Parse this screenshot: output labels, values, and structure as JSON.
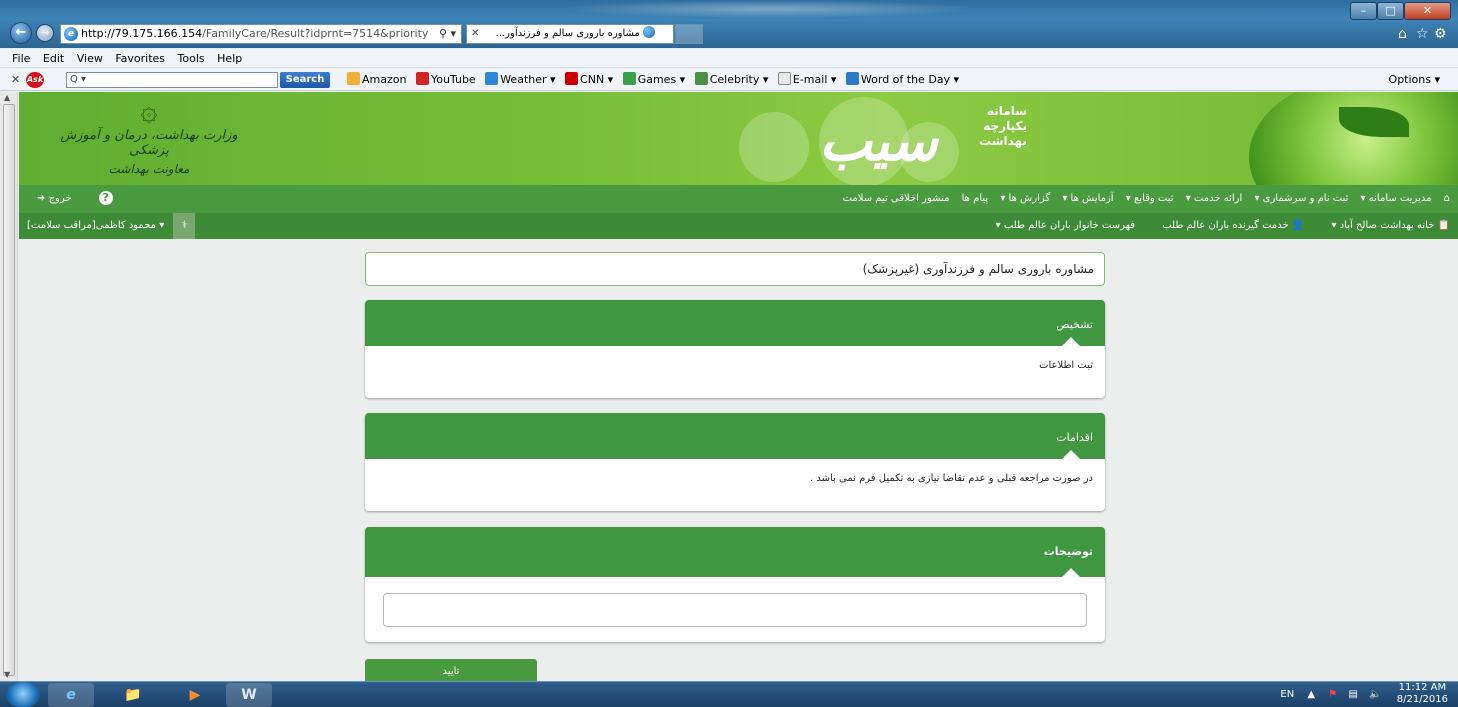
{
  "browser": {
    "address": {
      "host": "http://79.175.166.154",
      "path": "/FamilyCare/Result?idprnt=7514&priority"
    },
    "tab_title": "مشاوره باروری سالم و فرزندآور...",
    "menu": [
      "File",
      "Edit",
      "View",
      "Favorites",
      "Tools",
      "Help"
    ],
    "toolbar": {
      "search_button": "Search",
      "links": [
        "Amazon",
        "YouTube",
        "Weather ▾",
        "CNN ▾",
        "Games ▾",
        "Celebrity ▾",
        "E-mail ▾",
        "Word of the Day ▾"
      ],
      "options": "Options ▾"
    }
  },
  "header": {
    "ministry_line1": "وزارت بهداشت، درمان و آموزش پزشکی",
    "ministry_line2": "معاونت بهداشت",
    "brand_lines": [
      "سامانه",
      "یکپارچه",
      "بهداشت"
    ],
    "brand_name": "سیب"
  },
  "nav": {
    "items": [
      "مدیریت سامانه ▾",
      "ثبت نام و سرشماری ▾",
      "ارائه خدمت ▾",
      "ثبت وقایع ▾",
      "آزمایش ها ▾",
      "گزارش ها ▾",
      "پیام ها",
      "منشور اخلاقی تیم سلامت"
    ],
    "logout": "خروج"
  },
  "subnav": {
    "items": [
      "خانه بهداشت صالح آباد ▾",
      "خدمت گیرنده باران عالم طلب",
      "فهرست خانوار باران عالم طلب ▾"
    ],
    "user": "محمود کاظمی[مراقب سلامت] ▾"
  },
  "page": {
    "title": "مشاوره باروری سالم و فرزندآوری (غیرپزشک)",
    "panels": [
      {
        "heading": "تشخیص",
        "body": "ثبت اطلاعات"
      },
      {
        "heading": "اقدامات",
        "body": "در صورت مراجعه قبلی و عدم تقاضا نیازی به تکمیل فرم نمی باشد ."
      },
      {
        "heading": "توضیحات",
        "body": ""
      }
    ],
    "submit": "تایید"
  },
  "taskbar": {
    "lang": "EN",
    "time": "11:12 AM",
    "date": "8/21/2016"
  },
  "colors": {
    "green_primary": "#3f9740",
    "green_nav": "#4a9a3f",
    "green_subnav": "#3d8b36"
  }
}
